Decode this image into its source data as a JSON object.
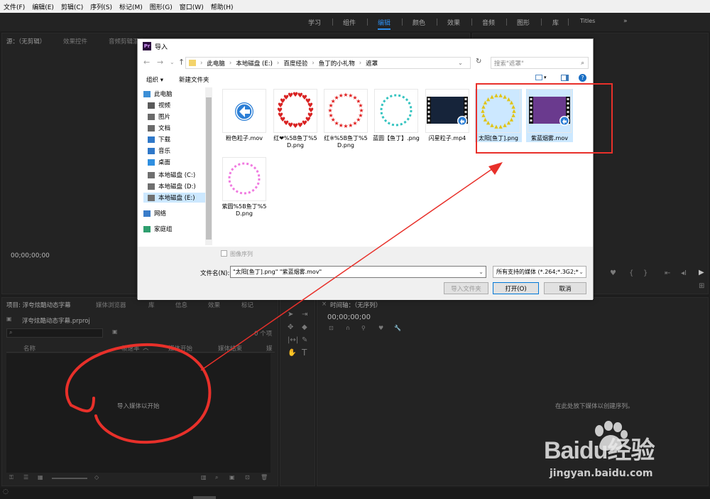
{
  "menu": [
    "文件(F)",
    "编辑(E)",
    "剪辑(C)",
    "序列(S)",
    "标记(M)",
    "图形(G)",
    "窗口(W)",
    "帮助(H)"
  ],
  "workspaces": [
    "学习",
    "组件",
    "编辑",
    "颜色",
    "效果",
    "音频",
    "图形",
    "库",
    "Titles"
  ],
  "workspace_more": "»",
  "source_panel": {
    "tab_main": "源：（无剪辑）",
    "tab_effects": "效果控件",
    "tab_audio": "音频剪辑混合器",
    "timecode": "00;00;00;00"
  },
  "project_panel": {
    "tab": "项目: 浮夸炫酷动态字幕",
    "tab_browser": "媒体浏览器",
    "tab_lib": "库",
    "tab_info": "信息",
    "tab_effects": "效果",
    "tab_markers": "标记",
    "file": "浮夸炫酷动态字幕.prproj",
    "item_count": "0 个项",
    "columns": [
      "名称",
      "帧速率",
      "媒体开始",
      "媒体结束",
      "媒"
    ],
    "empty_text": "导入媒体以开始"
  },
  "timeline_panel": {
    "tab": "时间轴：（无序列）",
    "timecode": "00;00;00;00",
    "empty_text": "在此处放下媒体以创建序列。"
  },
  "dialog": {
    "title": "导入",
    "path": [
      "此电脑",
      "本地磁盘 (E:)",
      "百度经验",
      "鱼丁的小礼物",
      "遮罩"
    ],
    "search_placeholder": "搜索\"遮罩\"",
    "organize": "组织 ▾",
    "new_folder": "新建文件夹",
    "nav": [
      {
        "label": "此电脑",
        "icon": "computer-icon"
      },
      {
        "label": "视频",
        "icon": "video-folder-icon"
      },
      {
        "label": "图片",
        "icon": "pictures-folder-icon"
      },
      {
        "label": "文档",
        "icon": "documents-folder-icon"
      },
      {
        "label": "下载",
        "icon": "download-icon"
      },
      {
        "label": "音乐",
        "icon": "music-icon"
      },
      {
        "label": "桌面",
        "icon": "desktop-icon"
      },
      {
        "label": "本地磁盘 (C:)",
        "icon": "drive-icon"
      },
      {
        "label": "本地磁盘 (D:)",
        "icon": "drive-icon"
      },
      {
        "label": "本地磁盘 (E:)",
        "icon": "drive-icon"
      },
      {
        "label": "网络",
        "icon": "network-icon"
      },
      {
        "label": "家庭组",
        "icon": "homegroup-icon"
      }
    ],
    "files": [
      {
        "name": "粉色粒子.mov",
        "kind": "mov",
        "selected": false
      },
      {
        "name": "红❤%5B鱼丁%5D.png",
        "kind": "hearts",
        "selected": false
      },
      {
        "name": "红※%5B鱼丁%5D.png",
        "kind": "stars",
        "selected": false
      },
      {
        "name": "蓝圆【鱼丁】.png",
        "kind": "cyan",
        "selected": false
      },
      {
        "name": "闪星粒子.mp4",
        "kind": "video-dark",
        "selected": false
      },
      {
        "name": "太阳[鱼丁].png",
        "kind": "sun",
        "selected": true
      },
      {
        "name": "紫蓝烟雾.mov",
        "kind": "video-purple",
        "selected": true
      },
      {
        "name": "紫圆%5B鱼丁%5D.png",
        "kind": "pink",
        "selected": false
      }
    ],
    "image_sequence": "图像序列",
    "filename_label": "文件名(N):",
    "filename_value": "\"太阳[鱼丁].png\" \"紫蓝烟雾.mov\"",
    "filetype": "所有支持的媒体 (*.264;*.3G2;*",
    "import_folder": "导入文件夹",
    "open": "打开(O)",
    "cancel": "取消"
  },
  "watermark": {
    "brand": "Baidu经验",
    "url": "jingyan.baidu.com"
  },
  "colors": {
    "accent": "#2d8ceb",
    "annotation": "#e8302a",
    "selection": "#cce8ff"
  }
}
